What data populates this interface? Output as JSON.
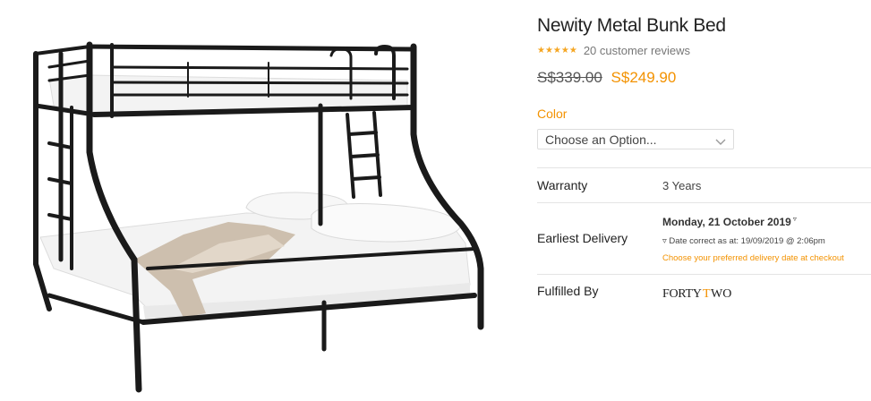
{
  "product": {
    "title": "Newity Metal Bunk Bed",
    "rating_stars": "★★★★★",
    "reviews": "20 customer reviews",
    "price_old": "S$339.00",
    "price_new": "S$249.90"
  },
  "options": {
    "color_label": "Color",
    "color_placeholder": "Choose an Option..."
  },
  "details": {
    "warranty_label": "Warranty",
    "warranty_value": "3 Years",
    "delivery_label": "Earliest Delivery",
    "delivery_date": "Monday, 21 October 2019",
    "delivery_marker": "▿",
    "delivery_note": "Date correct as at: 19/09/2019 @ 2:06pm",
    "delivery_link": "Choose your preferred delivery date at checkout",
    "fulfilled_label": "Fulfilled By",
    "fulfilled_logo_text": "FortyTwo"
  },
  "colors": {
    "accent": "#f39200",
    "star": "#f5a623",
    "bed_frame": "#1a1a1a"
  },
  "icons": {
    "select_chevron": "chevron-down-icon",
    "delivery_info": "triangle-down-icon"
  }
}
